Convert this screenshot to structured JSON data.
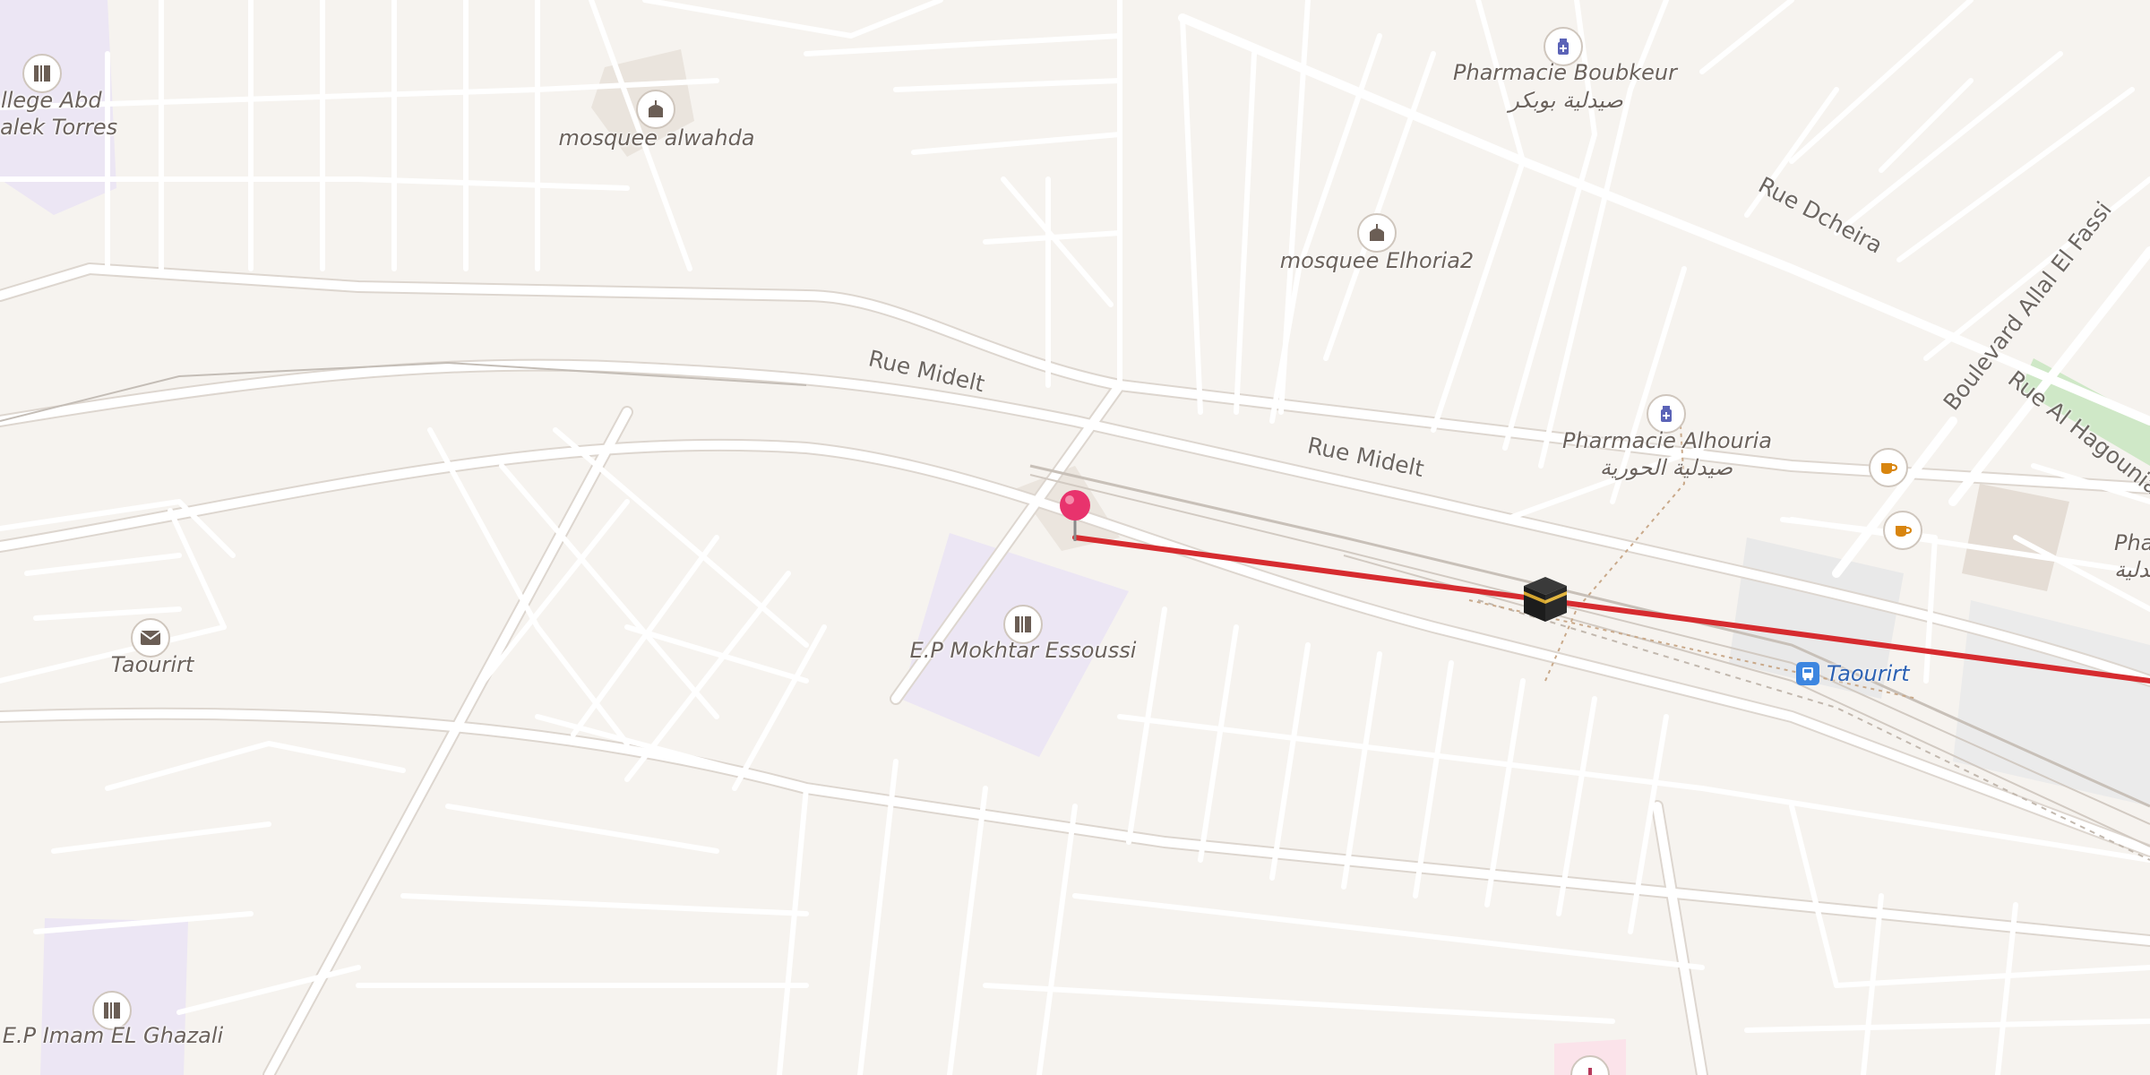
{
  "map": {
    "background_color": "#f6f3ef",
    "road_color": "#ffffff",
    "road_casing_color": "#ddd6cf",
    "school_area_color": "#ece6f4",
    "route_color": "#d62b2f",
    "pin_color": "#e8336d"
  },
  "places": {
    "college": {
      "label_line1": "ollege Abd",
      "label_line2": "halek Torres",
      "icon": "school-icon"
    },
    "mosquee_alwahda": {
      "label": "mosquee alwahda",
      "icon": "mosque-icon"
    },
    "mosquee_elhoria2": {
      "label": "mosquee Elhoria2",
      "icon": "mosque-icon"
    },
    "pharmacie_boubkeur": {
      "label": "Pharmacie Boubkeur",
      "label_ar": "صيدلية بوبكر",
      "icon": "pharmacy-icon"
    },
    "pharmacie_alhouria": {
      "label": "Pharmacie Alhouria",
      "label_ar": "صيدلية الحورية",
      "icon": "pharmacy-icon"
    },
    "pharmacie_partial": {
      "label": "Pharm",
      "label_ar": "صيدلية",
      "icon": "pharmacy-icon"
    },
    "post_office": {
      "label": "Taourirt",
      "icon": "mail-icon"
    },
    "school_mokhtar": {
      "label": "E.P Mokhtar Essoussi",
      "icon": "school-icon"
    },
    "school_ghazali": {
      "label": "E.P Imam EL Ghazali",
      "icon": "school-icon"
    },
    "bus_station": {
      "label": "Taourirt",
      "icon": "bus-icon"
    },
    "cafe_1": {
      "icon": "cafe-icon"
    },
    "cafe_2": {
      "icon": "cafe-icon"
    },
    "qibla_marker": {
      "icon": "kaaba-icon"
    },
    "location_pin": {
      "icon": "map-pin-icon"
    }
  },
  "streets": {
    "rue_midelt_1": "Rue Midelt",
    "rue_midelt_2": "Rue Midelt",
    "rue_dcheira": "Rue Dcheira",
    "boulevard_allal_el_fassi": "Boulevard Allal El Fassi",
    "rue_al_hagounia": "Rue Al Hagounia"
  }
}
